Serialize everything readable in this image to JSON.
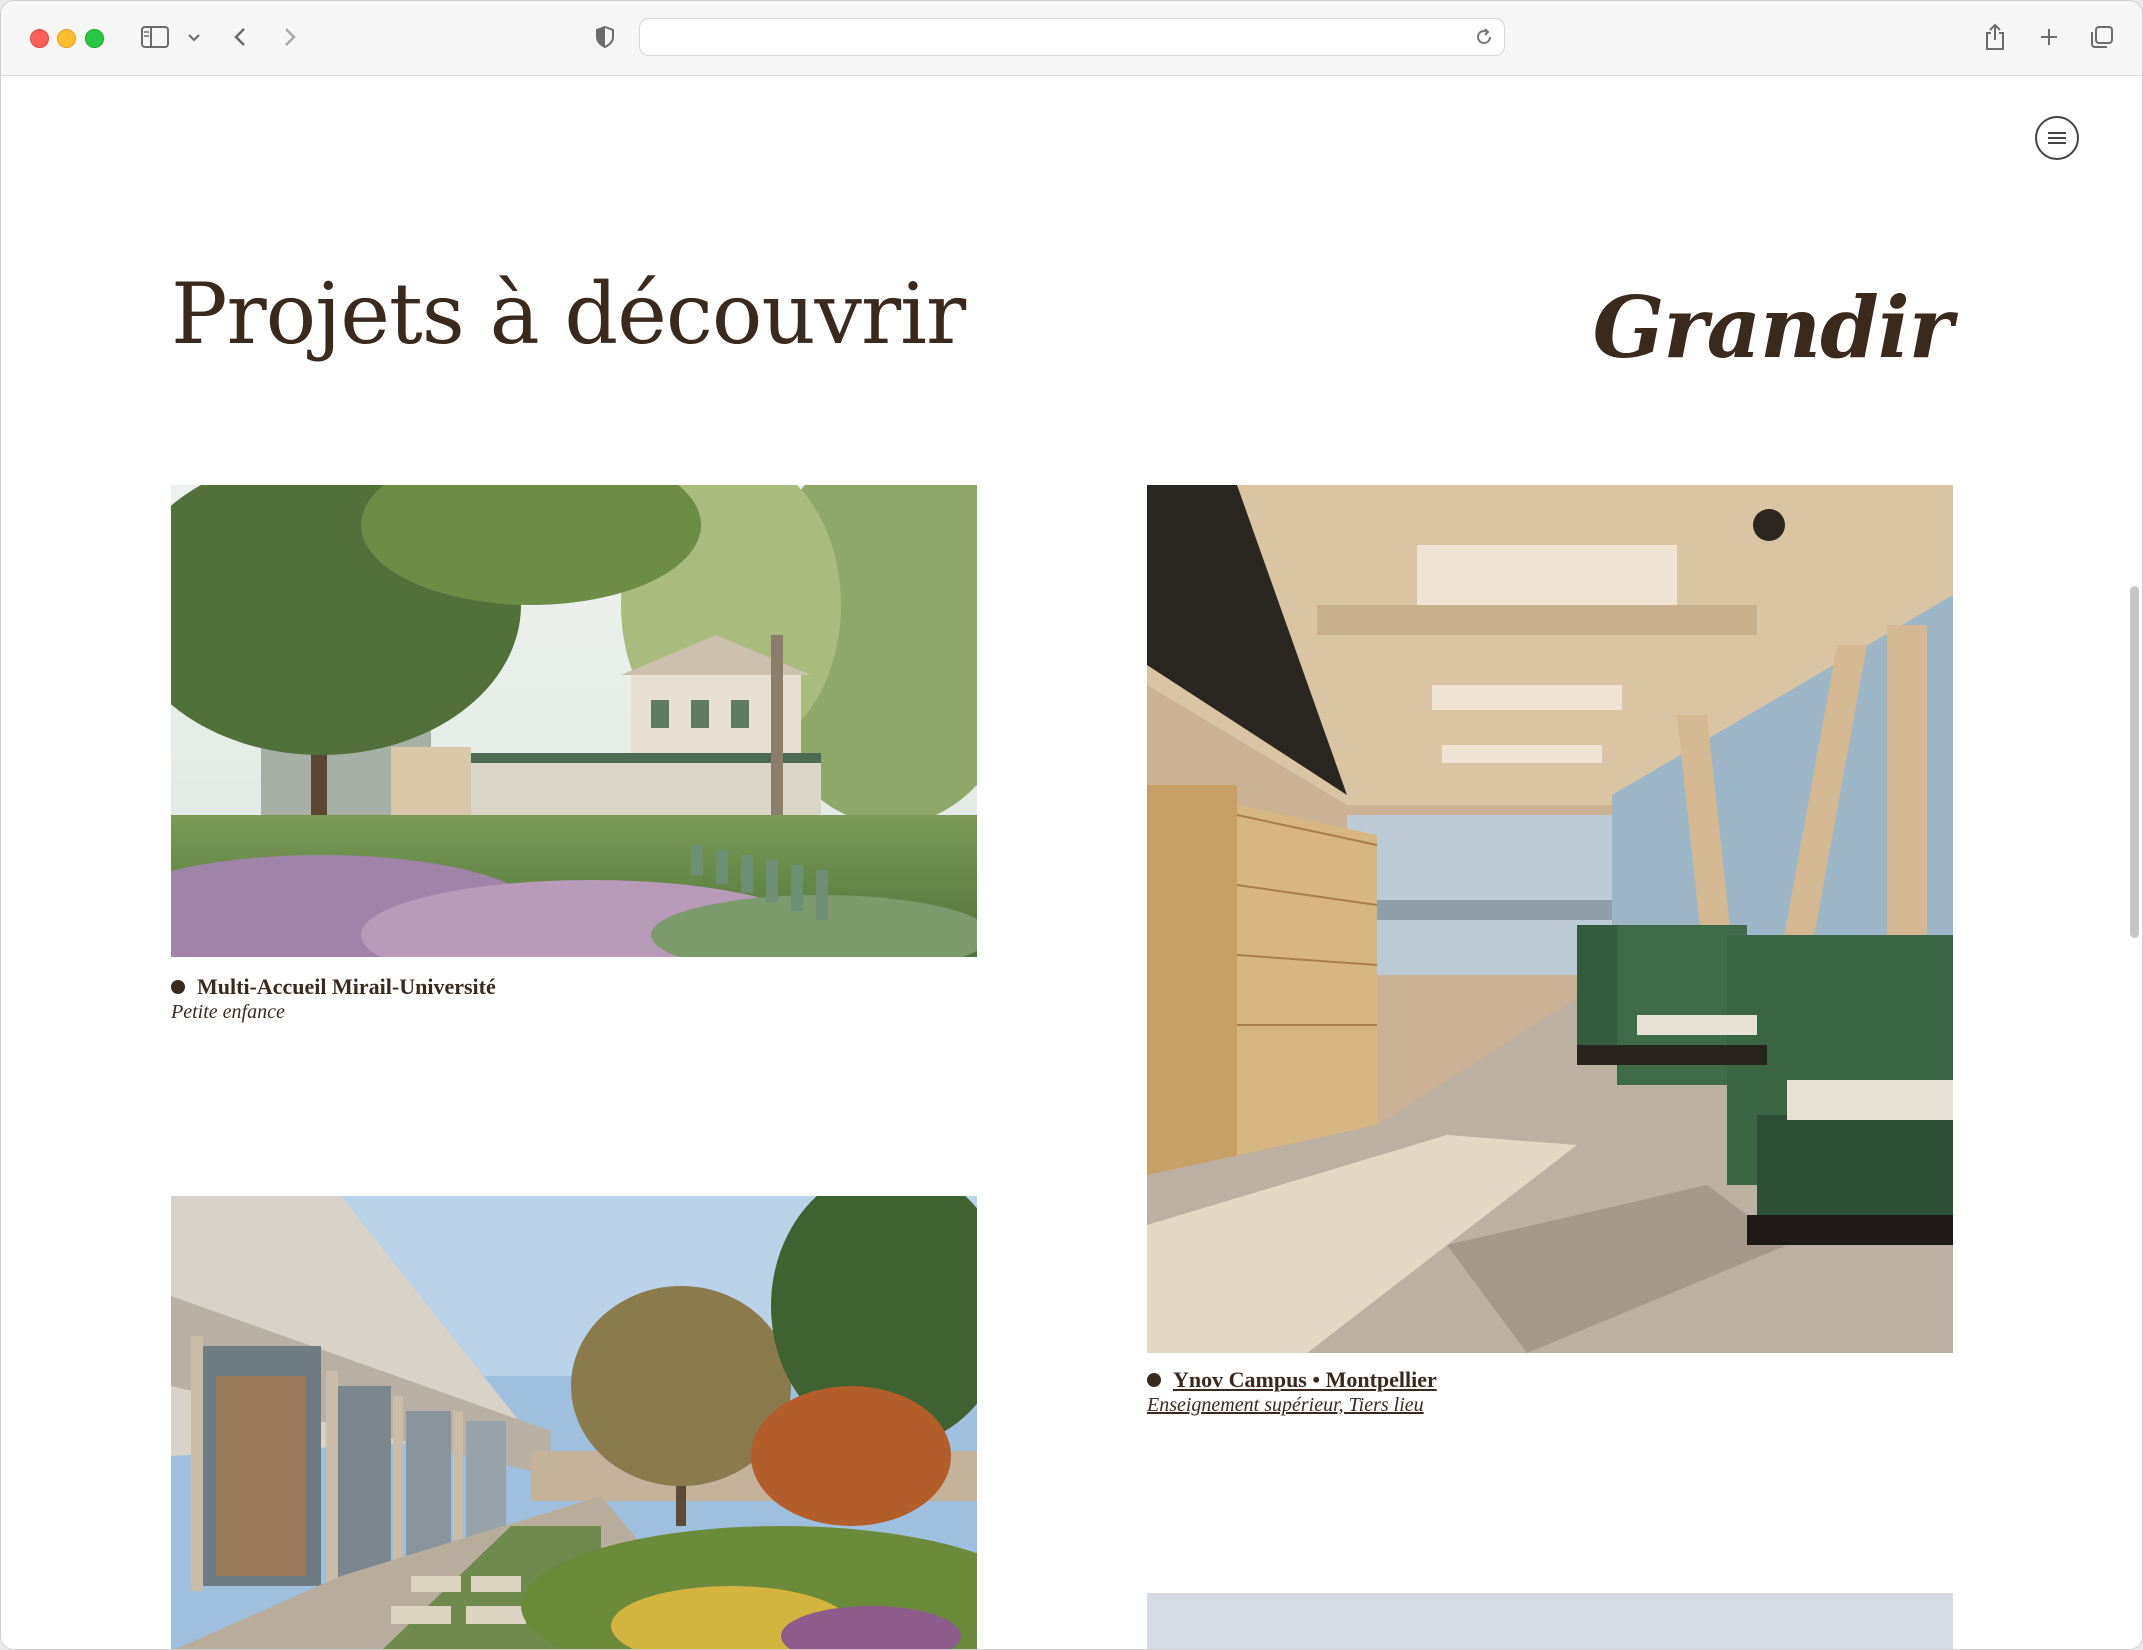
{
  "browser": {
    "icons": {
      "sidebar": "sidebar-icon",
      "chevron": "chevron-down-icon",
      "back": "back-arrow-icon",
      "forward": "forward-arrow-icon",
      "privacy": "shield-icon",
      "reload": "reload-icon",
      "share": "share-icon",
      "new_tab": "plus-icon",
      "tabs": "tabs-overview-icon"
    }
  },
  "page": {
    "title": "Projets à découvrir",
    "category_title": "Grandir",
    "menu_icon": "menu-icon"
  },
  "projects": [
    {
      "name": "Multi-Accueil Mirail-Université",
      "category": "Petite enfance"
    },
    {
      "name": "Ynov Campus • Montpellier",
      "category": "Enseignement supérieur, Tiers lieu"
    }
  ],
  "colors": {
    "text": "#3a2a1e",
    "background": "#ffffff",
    "toolbar": "#f6f6f6"
  }
}
